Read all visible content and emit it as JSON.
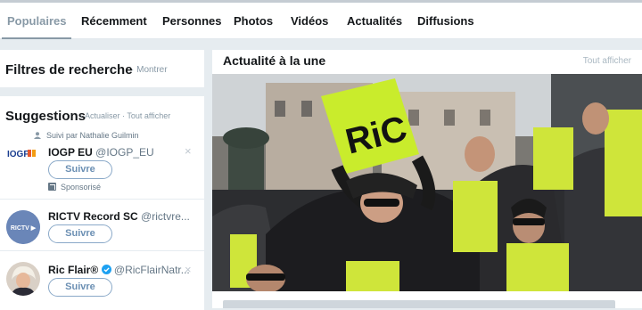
{
  "tabs": [
    {
      "label": "Populaires",
      "active": true
    },
    {
      "label": "Récemment"
    },
    {
      "label": "Personnes"
    },
    {
      "label": "Photos"
    },
    {
      "label": "Vidéos"
    },
    {
      "label": "Actualités"
    },
    {
      "label": "Diffusions"
    }
  ],
  "filters": {
    "title": "Filtres de recherche",
    "show_link": "· Montrer"
  },
  "suggestions": {
    "title": "Suggestions",
    "links": "· Actualiser · Tout afficher",
    "items": [
      {
        "followed_by": "Suivi par Nathalie Guilmin",
        "name": "IOGP EU",
        "handle": "@IOGP_EU",
        "button": "Suivre",
        "sponsored": "Sponsorisé",
        "logo_text": "IOGP"
      },
      {
        "name": "RICTV Record SC",
        "handle": "@rictvre...",
        "button": "Suivre",
        "logo_text": "RICTV ▶"
      },
      {
        "name": "Ric Flair®",
        "handle": "@RicFlairNatr...",
        "button": "Suivre"
      }
    ]
  },
  "news": {
    "title": "Actualité à la une",
    "all_link": "Tout afficher",
    "photo_sign_text": "RiC"
  },
  "colors": {
    "background": "#e6ecf0",
    "verified": "#1da1f2",
    "follow_border": "#8aa9c8",
    "vest": "#cfe53a",
    "sign": "#c9ec2c"
  },
  "icons": [
    "person-icon",
    "close-icon",
    "sponsored-icon",
    "verified-badge-icon"
  ]
}
